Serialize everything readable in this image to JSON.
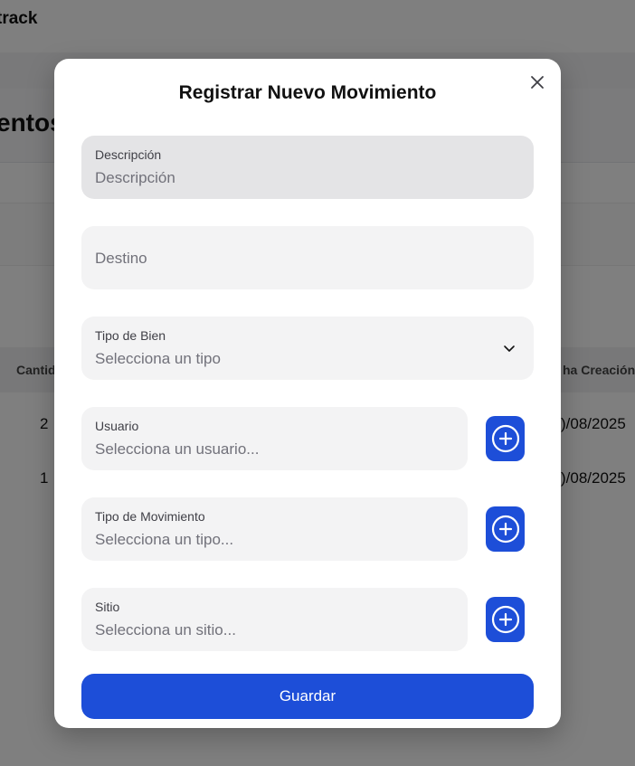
{
  "app": {
    "brand": "track",
    "page_title": "entos",
    "table": {
      "headers": {
        "quantity": "Cantid",
        "created_date": "ha Creación"
      },
      "rows": [
        {
          "quantity": "2",
          "created_date": ")/08/2025"
        },
        {
          "quantity": "1",
          "created_date": ")/08/2025"
        }
      ]
    }
  },
  "modal": {
    "title": "Registrar Nuevo Movimiento",
    "close_icon": "close-icon",
    "fields": {
      "descripcion": {
        "label": "Descripción",
        "placeholder": "Descripción",
        "value": ""
      },
      "destino": {
        "placeholder": "Destino",
        "value": ""
      },
      "tipo_bien": {
        "label": "Tipo de Bien",
        "selected": "Selecciona un tipo"
      },
      "usuario": {
        "label": "Usuario",
        "selected": "Selecciona un usuario..."
      },
      "tipo_movimiento": {
        "label": "Tipo de Movimiento",
        "selected": "Selecciona un tipo..."
      },
      "sitio": {
        "label": "Sitio",
        "selected": "Selecciona un sitio..."
      }
    },
    "add_icon": "plus-circle-icon",
    "save_label": "Guardar"
  },
  "colors": {
    "primary": "#1d4ed8",
    "field_bg": "#f3f3f4",
    "field_active_bg": "#e4e4e6",
    "overlay": "rgba(0,0,0,0.5)"
  }
}
